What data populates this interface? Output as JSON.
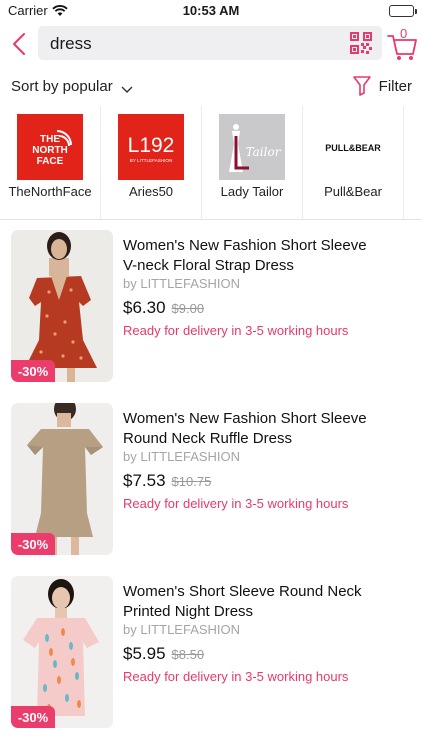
{
  "status_bar": {
    "carrier": "Carrier",
    "time": "10:53 AM"
  },
  "header": {
    "search_query": "dress",
    "cart_count": "0"
  },
  "sort_bar": {
    "sort_label": "Sort by popular",
    "filter_label": "Filter"
  },
  "brands": [
    {
      "name": "TheNorthFace",
      "logo_text": [
        "THE",
        "NORTH",
        "FACE"
      ]
    },
    {
      "name": "Aries50",
      "logo_text": [
        "L192",
        "BY LITTLEFASHION"
      ]
    },
    {
      "name": "Lady Tailor",
      "logo_text": [
        "Tailor"
      ]
    },
    {
      "name": "Pull&Bear",
      "logo_text": [
        "PULL&BEAR"
      ]
    }
  ],
  "products": [
    {
      "title_line1": "Women's New Fashion Short Sleeve",
      "title_line2": "V-neck Floral Strap Dress",
      "brand": "by LITTLEFASHION",
      "price": "$6.30",
      "old_price": "$9.00",
      "delivery": "Ready for delivery in 3-5 working hours",
      "discount": "-30%"
    },
    {
      "title_line1": "Women's New Fashion Short Sleeve",
      "title_line2": "Round Neck Ruffle Dress",
      "brand": "by LITTLEFASHION",
      "price": "$7.53",
      "old_price": "$10.75",
      "delivery": "Ready for delivery in 3-5 working hours",
      "discount": "-30%"
    },
    {
      "title_line1": "Women's Short Sleeve Round Neck",
      "title_line2": "Printed Night Dress",
      "brand": "by LITTLEFASHION",
      "price": "$5.95",
      "old_price": "$8.50",
      "delivery": "Ready for delivery in 3-5 working hours",
      "discount": "-30%"
    }
  ],
  "colors": {
    "accent": "#e8396c",
    "northface_red": "#e2231a",
    "badge": "#ea3d6c"
  }
}
